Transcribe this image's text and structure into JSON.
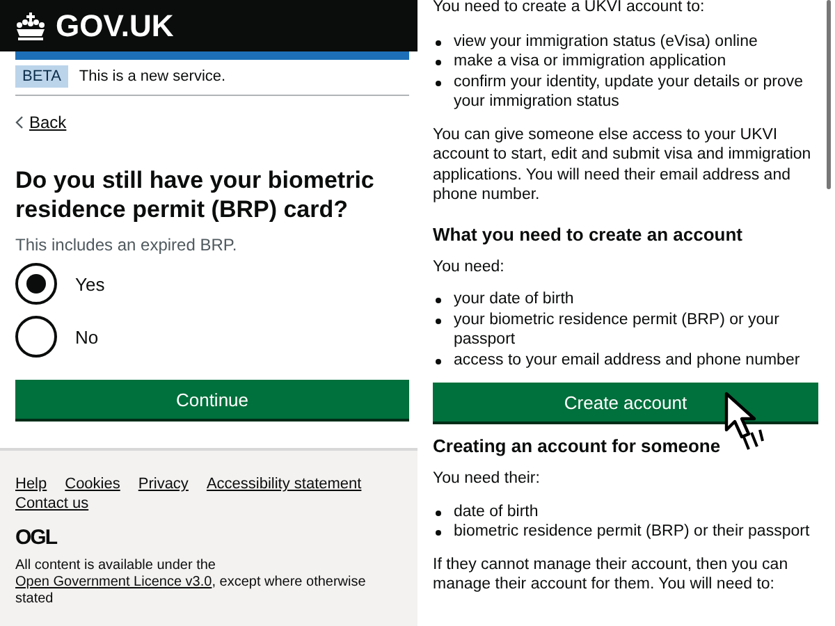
{
  "left_screen": {
    "header": {
      "logo_text": "GOV.UK"
    },
    "phase_banner": {
      "tag": "BETA",
      "text": "This is a new service."
    },
    "back_link": "Back",
    "question": {
      "heading": "Do you still have your biometric residence permit (BRP) card?",
      "hint": "This includes an expired BRP.",
      "options": [
        {
          "label": "Yes",
          "selected": true
        },
        {
          "label": "No",
          "selected": false
        }
      ]
    },
    "continue_button": "Continue",
    "footer": {
      "links": [
        "Help",
        "Cookies",
        "Privacy",
        "Accessibility statement",
        "Contact us"
      ],
      "ogl_logo": "OGL",
      "licence_before": "All content is available under the",
      "licence_link": "Open Government Licence v3.0",
      "licence_after": ", except where otherwise stated"
    }
  },
  "right_screen": {
    "intro": "You need to create a UKVI account to:",
    "list_1": [
      "view your immigration status (eVisa) online",
      "make a visa or immigration application",
      "confirm your identity, update your details or prove your immigration status"
    ],
    "paragraph_1": "You can give someone else access to your UKVI account to start, edit and submit visa and immigration applications. You will need their email address and phone number.",
    "heading_1": "What you need to create an account",
    "you_need": "You need:",
    "list_2": [
      "your date of birth",
      "your biometric residence permit (BRP) or your passport",
      "access to your email address and phone number"
    ],
    "create_button": "Create account",
    "heading_2": "Creating an account for someone",
    "you_need_their": "You need their:",
    "list_3": [
      "date of birth",
      "biometric residence permit (BRP) or their passport"
    ],
    "paragraph_2": "If they cannot manage their account, then you can manage their account for them. You will need to:"
  }
}
